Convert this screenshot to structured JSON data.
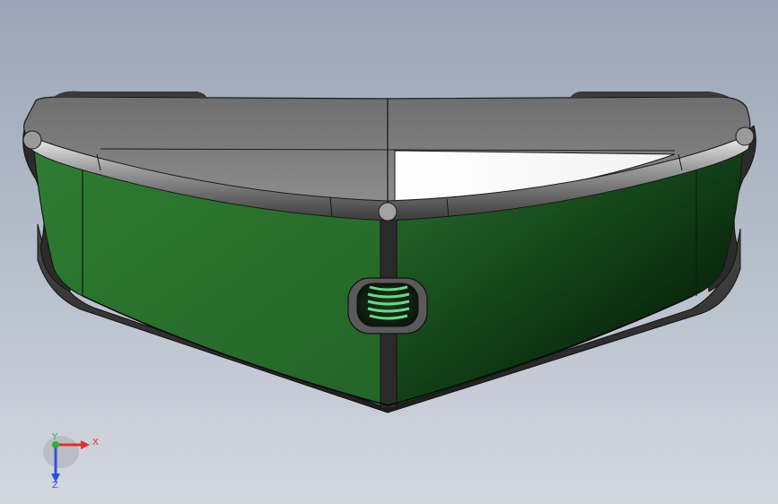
{
  "viewport": {
    "background_top": "#9aa6b7",
    "background_bottom": "#d4d8df"
  },
  "model": {
    "face_color": "#2e7a32",
    "top_color": "#8a8a8a",
    "edge_color": "#1a1a1a",
    "thread_color": "#5fd07a"
  },
  "triad": {
    "x_label": "X",
    "y_label": "Y",
    "z_label": "Z",
    "x_color": "#e03030",
    "y_color": "#30b030",
    "z_color": "#3050e0"
  }
}
